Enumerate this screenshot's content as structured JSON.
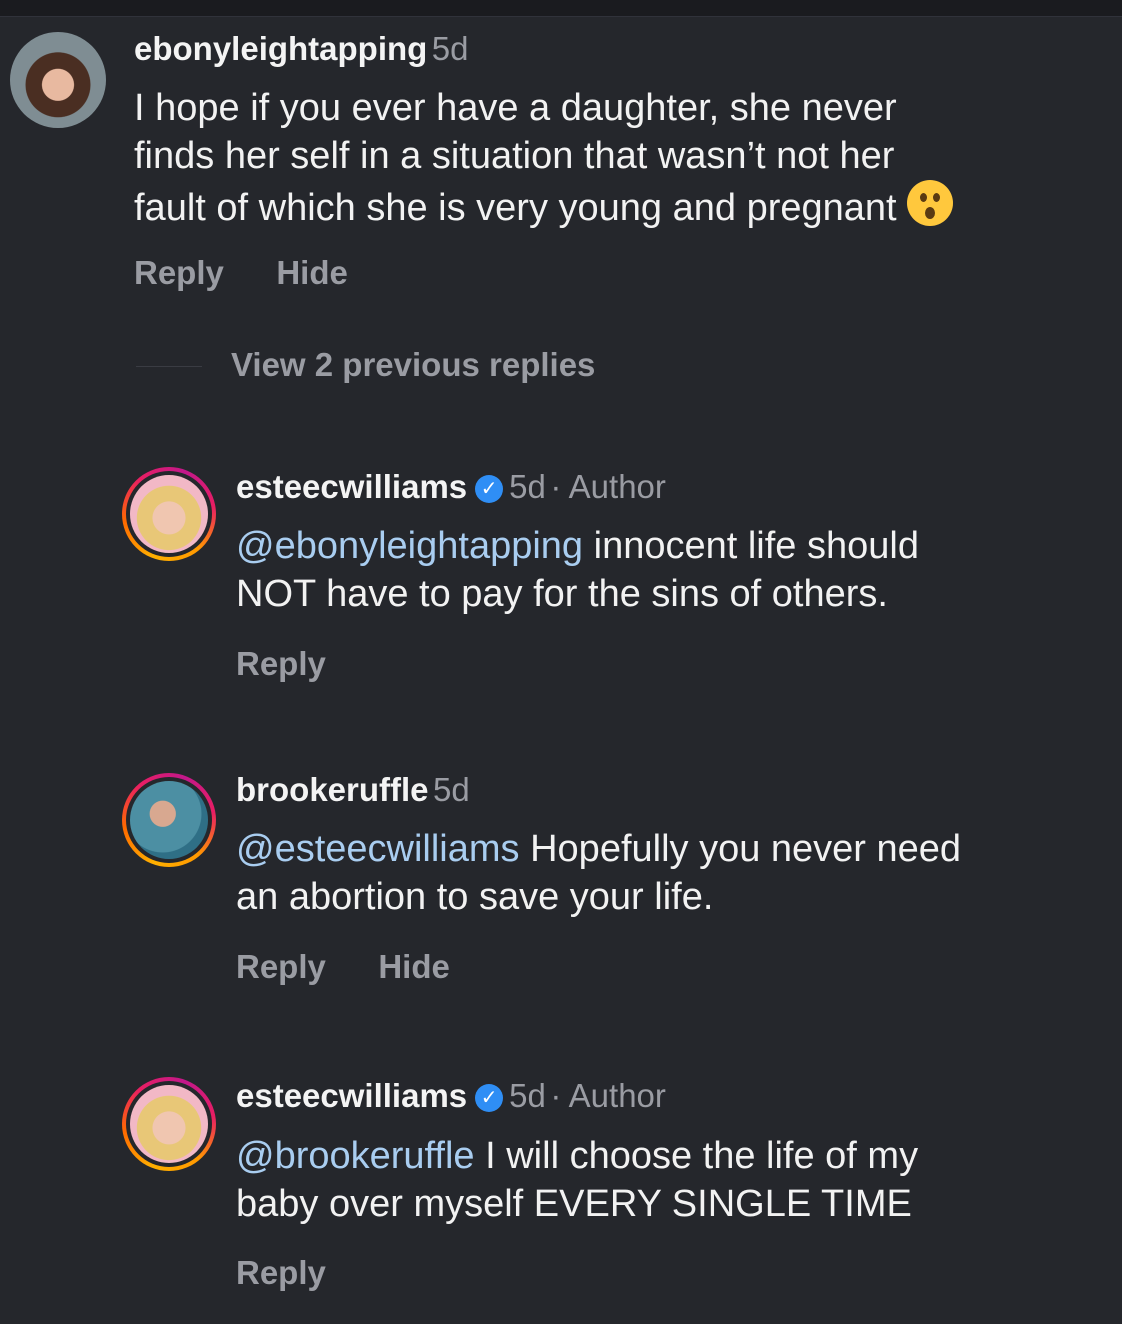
{
  "comment": {
    "username": "ebonyleightapping",
    "time": "5d",
    "lines": [
      "I hope if you ever have a daughter, she never",
      "finds her self in a situation that wasn’t not her",
      "fault of which she is very young and pregnant"
    ],
    "emoji": "hushed-face",
    "reply": "Reply",
    "hide": "Hide"
  },
  "view_replies": "View 2 previous replies",
  "replies": [
    {
      "username": "esteecwilliams",
      "verified": true,
      "time": "5d",
      "tag": "· Author",
      "mention": "@ebonyleightapping",
      "lines": [
        " innocent life should",
        "NOT have to pay for the sins of others."
      ],
      "reply": "Reply"
    },
    {
      "username": "brookeruffle",
      "verified": false,
      "time": "5d",
      "mention": "@esteecwilliams",
      "lines": [
        " Hopefully you never need",
        "an abortion to save your life."
      ],
      "reply": "Reply",
      "hide": "Hide"
    },
    {
      "username": "esteecwilliams",
      "verified": true,
      "time": "5d",
      "tag": "· Author",
      "mention": "@brookeruffle",
      "lines": [
        " I will choose the life of my",
        "baby over myself EVERY SINGLE TIME"
      ],
      "reply": "Reply"
    }
  ],
  "colors": {
    "bg": "#25272c",
    "mention": "#a9cdf0",
    "verified": "#2f8ef5"
  }
}
